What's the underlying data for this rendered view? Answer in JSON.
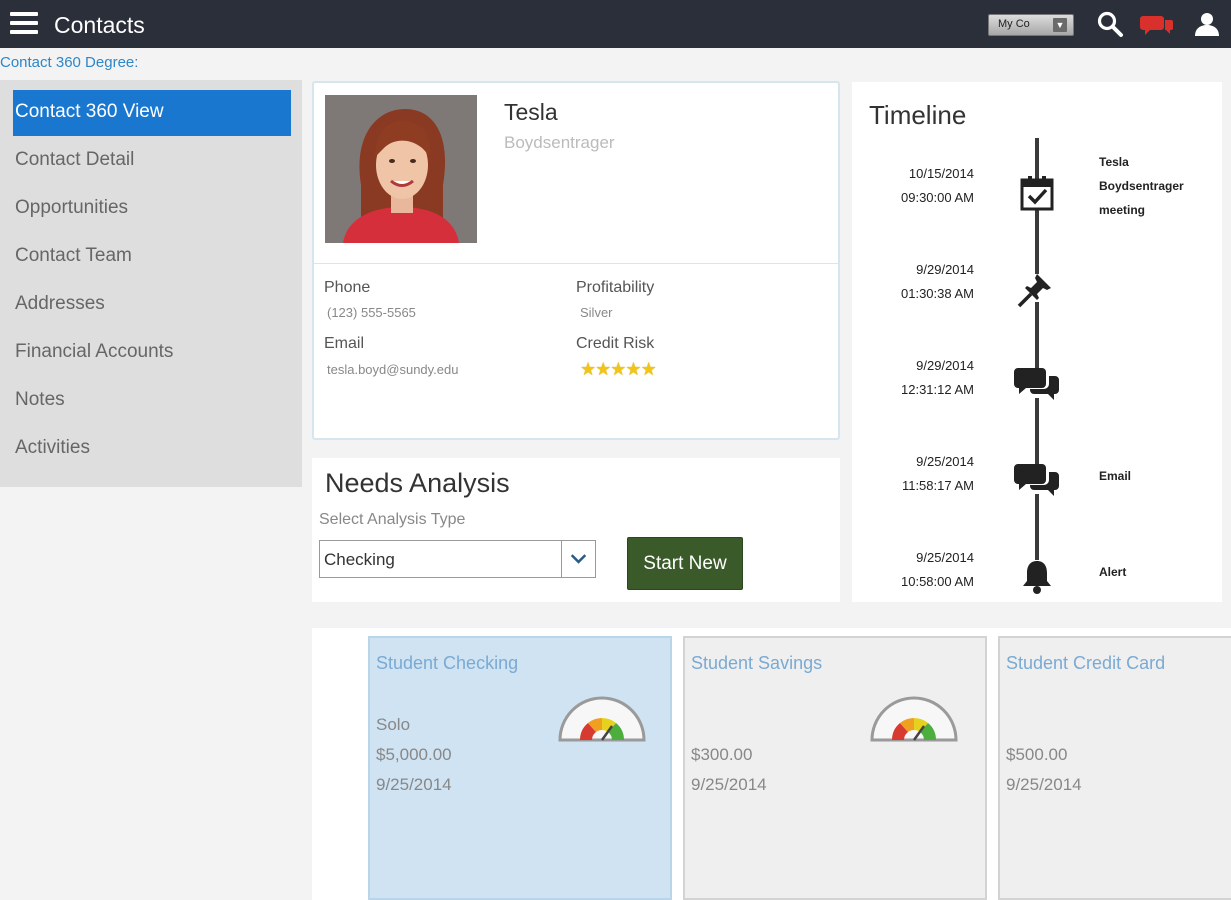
{
  "header": {
    "title": "Contacts",
    "company_button": "My Co"
  },
  "breadcrumb": "Contact 360 Degree:",
  "sidebar": {
    "items": [
      {
        "label": "Contact 360 View"
      },
      {
        "label": "Contact Detail"
      },
      {
        "label": "Opportunities"
      },
      {
        "label": "Contact Team"
      },
      {
        "label": "Addresses"
      },
      {
        "label": "Financial Accounts"
      },
      {
        "label": "Notes"
      },
      {
        "label": "Activities"
      }
    ]
  },
  "profile": {
    "name": "Tesla",
    "subtitle": "Boydsentrager",
    "phone_label": "Phone",
    "phone": "(123) 555-5565",
    "email_label": "Email",
    "email": "tesla.boyd@sundy.edu",
    "profitability_label": "Profitability",
    "profitability": "Silver",
    "credit_risk_label": "Credit Risk",
    "credit_risk_stars": 5
  },
  "needs": {
    "title": "Needs Analysis",
    "select_label": "Select Analysis Type",
    "selected": "Checking",
    "start_button": "Start New"
  },
  "timeline": {
    "title": "Timeline",
    "events": [
      {
        "date": "10/15/2014",
        "time": "09:30:00 AM",
        "icon": "calendar-check-icon",
        "text_lines": [
          "Tesla",
          "Boydsentrager",
          "meeting"
        ]
      },
      {
        "date": "9/29/2014",
        "time": "01:30:38 AM",
        "icon": "pushpin-icon",
        "text_lines": []
      },
      {
        "date": "9/29/2014",
        "time": "12:31:12 AM",
        "icon": "chat-icon",
        "text_lines": []
      },
      {
        "date": "9/25/2014",
        "time": "11:58:17 AM",
        "icon": "chat-icon",
        "text_lines": [
          "Email"
        ]
      },
      {
        "date": "9/25/2014",
        "time": "10:58:00 AM",
        "icon": "bell-icon",
        "text_lines": [
          "Alert"
        ]
      }
    ]
  },
  "products": [
    {
      "title": "Student Checking",
      "lines": [
        "Solo",
        "$5,000.00",
        "9/25/2014"
      ],
      "has_gauge": true,
      "selected": true
    },
    {
      "title": "Student Savings",
      "lines": [
        "$300.00",
        "9/25/2014"
      ],
      "has_gauge": true,
      "selected": false
    },
    {
      "title": "Student Credit Card",
      "lines": [
        "$500.00",
        "9/25/2014"
      ],
      "has_gauge": false,
      "selected": false
    }
  ],
  "colors": {
    "topbar": "#2b2f3a",
    "accent": "#1a77cf",
    "start_button": "#3a5a2a",
    "alert_icon": "#d9302c",
    "star": "#f1c416"
  }
}
